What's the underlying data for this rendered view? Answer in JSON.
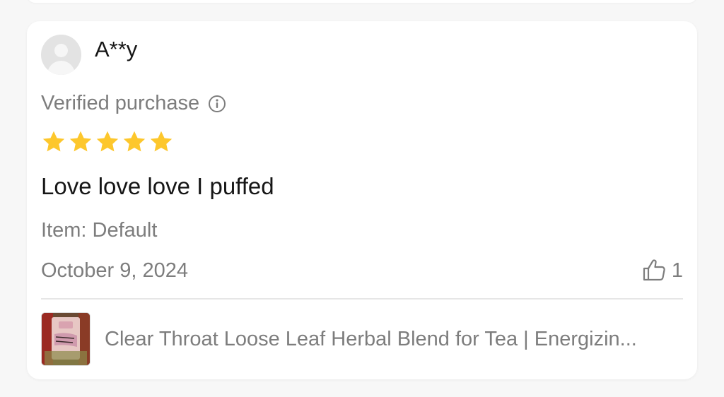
{
  "review": {
    "username": "A**y",
    "verified_label": "Verified purchase",
    "rating": 5,
    "text": "Love love love I puffed",
    "item_label": "Item: Default",
    "date": "October 9, 2024",
    "likes": "1",
    "product_title": "Clear Throat Loose Leaf Herbal Blend for Tea | Energizin..."
  },
  "icons": {
    "info": "info-circle-icon",
    "star": "star-icon",
    "like": "thumbs-up-icon",
    "avatar": "default-avatar-icon"
  },
  "colors": {
    "star": "#FDC72C",
    "muted_text": "#7D7D7D",
    "primary_text": "#161616"
  }
}
